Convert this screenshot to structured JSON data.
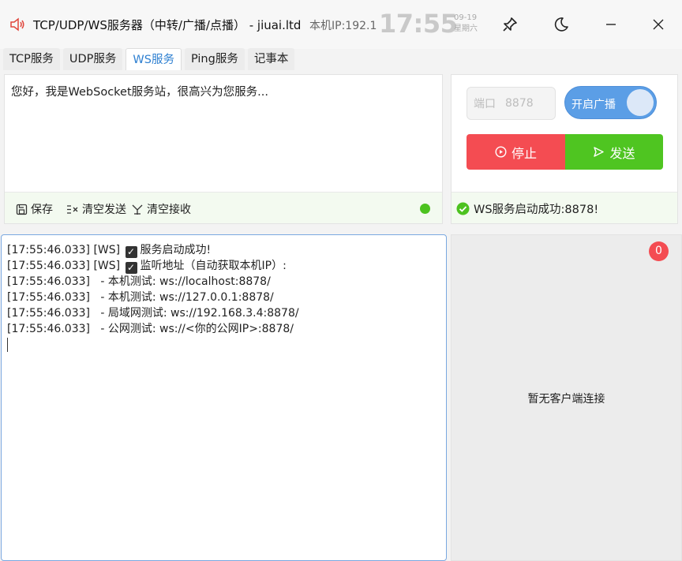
{
  "window": {
    "title": "TCP/UDP/WS服务器（中转/广播/点播） - jiuai.ltd",
    "ip_label": "本机IP:192.1",
    "clock": "17:55",
    "date": "09-19",
    "weekday": "星期六"
  },
  "tabs": [
    {
      "label": "TCP服务",
      "active": false
    },
    {
      "label": "UDP服务",
      "active": false
    },
    {
      "label": "WS服务",
      "active": true
    },
    {
      "label": "Ping服务",
      "active": false
    },
    {
      "label": "记事本",
      "active": false
    }
  ],
  "send_panel": {
    "message": "您好，我是WebSocket服务站，很高兴为您服务...",
    "save_label": "保存",
    "clear_send_label": "清空发送",
    "clear_recv_label": "清空接收"
  },
  "control": {
    "port_label": "端口",
    "port_value": "8878",
    "broadcast_label": "开启广播",
    "broadcast_on": true,
    "stop_label": "停止",
    "send_label": "发送",
    "status_text": "WS服务启动成功:8878!"
  },
  "log": [
    {
      "time": "[17:55:46.033]",
      "tag": "[WS]",
      "check": true,
      "text": "服务启动成功!"
    },
    {
      "time": "[17:55:46.033]",
      "tag": "[WS]",
      "check": true,
      "text": "监听地址（自动获取本机IP）:"
    },
    {
      "time": "[17:55:46.033]",
      "tag": "",
      "check": false,
      "text": "   - 本机测试: ws://localhost:8878/"
    },
    {
      "time": "[17:55:46.033]",
      "tag": "",
      "check": false,
      "text": "   - 本机测试: ws://127.0.0.1:8878/"
    },
    {
      "time": "[17:55:46.033]",
      "tag": "",
      "check": false,
      "text": "   - 局域网测试: ws://192.168.3.4:8878/"
    },
    {
      "time": "[17:55:46.033]",
      "tag": "",
      "check": false,
      "text": "   - 公网测试: ws://<你的公网IP>:8878/"
    }
  ],
  "clients": {
    "count": "0",
    "empty_text": "暂无客户端连接"
  },
  "colors": {
    "accent": "#2f80d1",
    "stop": "#f44c52",
    "send": "#4fc521",
    "toggle": "#5b9ee6"
  }
}
